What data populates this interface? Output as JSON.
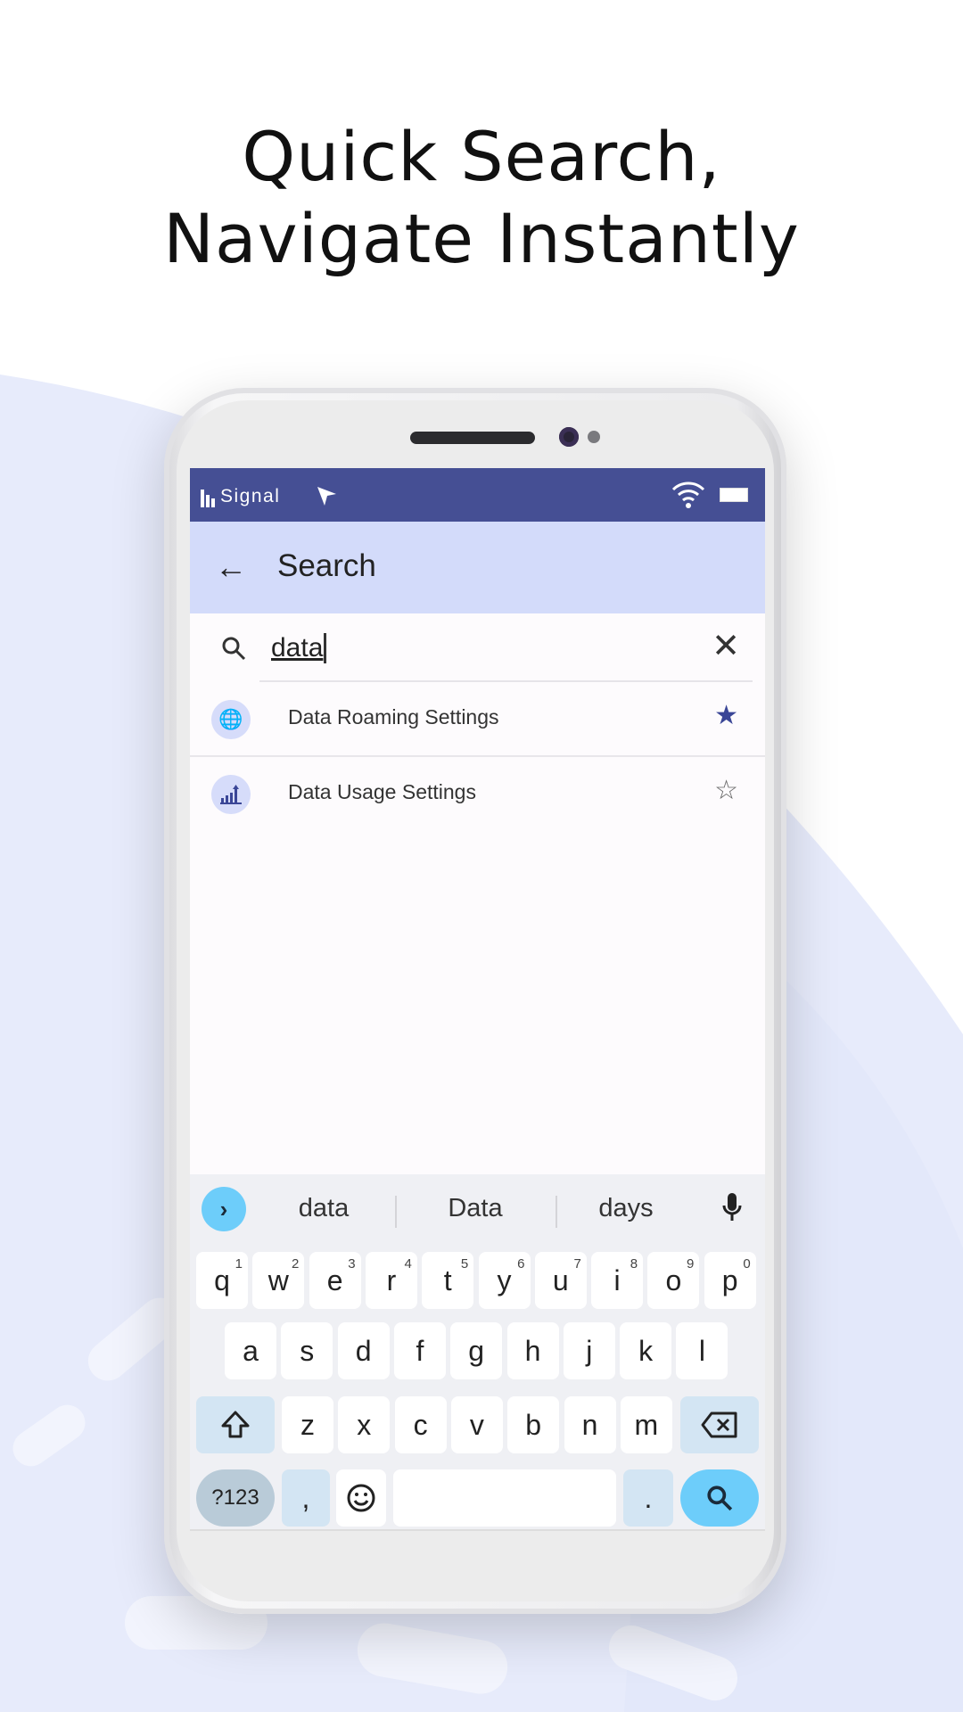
{
  "headline": {
    "line1": "Quick Search,",
    "line2": "Navigate Instantly"
  },
  "colors": {
    "status_bar": "#454f94",
    "app_bar": "#d3dbfa",
    "accent_star": "#3a4697",
    "keyboard_action": "#6dcdfa"
  },
  "status_bar": {
    "carrier": "Signal",
    "icons": [
      "signal-bars-icon",
      "location-arrow-icon",
      "wifi-icon",
      "battery-icon"
    ]
  },
  "app_bar": {
    "title": "Search",
    "back_icon": "arrow-left-icon"
  },
  "search": {
    "value": "data",
    "search_icon": "search-icon",
    "clear_icon": "close-icon"
  },
  "results": [
    {
      "label": "Data Roaming Settings",
      "icon": "globe-phone-icon",
      "favorite": true
    },
    {
      "label": "Data Usage Settings",
      "icon": "bar-chart-up-icon",
      "favorite": false
    }
  ],
  "keyboard": {
    "suggestions": [
      "data",
      "Data",
      "days"
    ],
    "row1": [
      {
        "k": "q",
        "n": "1"
      },
      {
        "k": "w",
        "n": "2"
      },
      {
        "k": "e",
        "n": "3"
      },
      {
        "k": "r",
        "n": "4"
      },
      {
        "k": "t",
        "n": "5"
      },
      {
        "k": "y",
        "n": "6"
      },
      {
        "k": "u",
        "n": "7"
      },
      {
        "k": "i",
        "n": "8"
      },
      {
        "k": "o",
        "n": "9"
      },
      {
        "k": "p",
        "n": "0"
      }
    ],
    "row2": [
      "a",
      "s",
      "d",
      "f",
      "g",
      "h",
      "j",
      "k",
      "l"
    ],
    "row3": [
      "z",
      "x",
      "c",
      "v",
      "b",
      "n",
      "m"
    ],
    "symbols": "?123",
    "comma": ",",
    "period": "."
  }
}
